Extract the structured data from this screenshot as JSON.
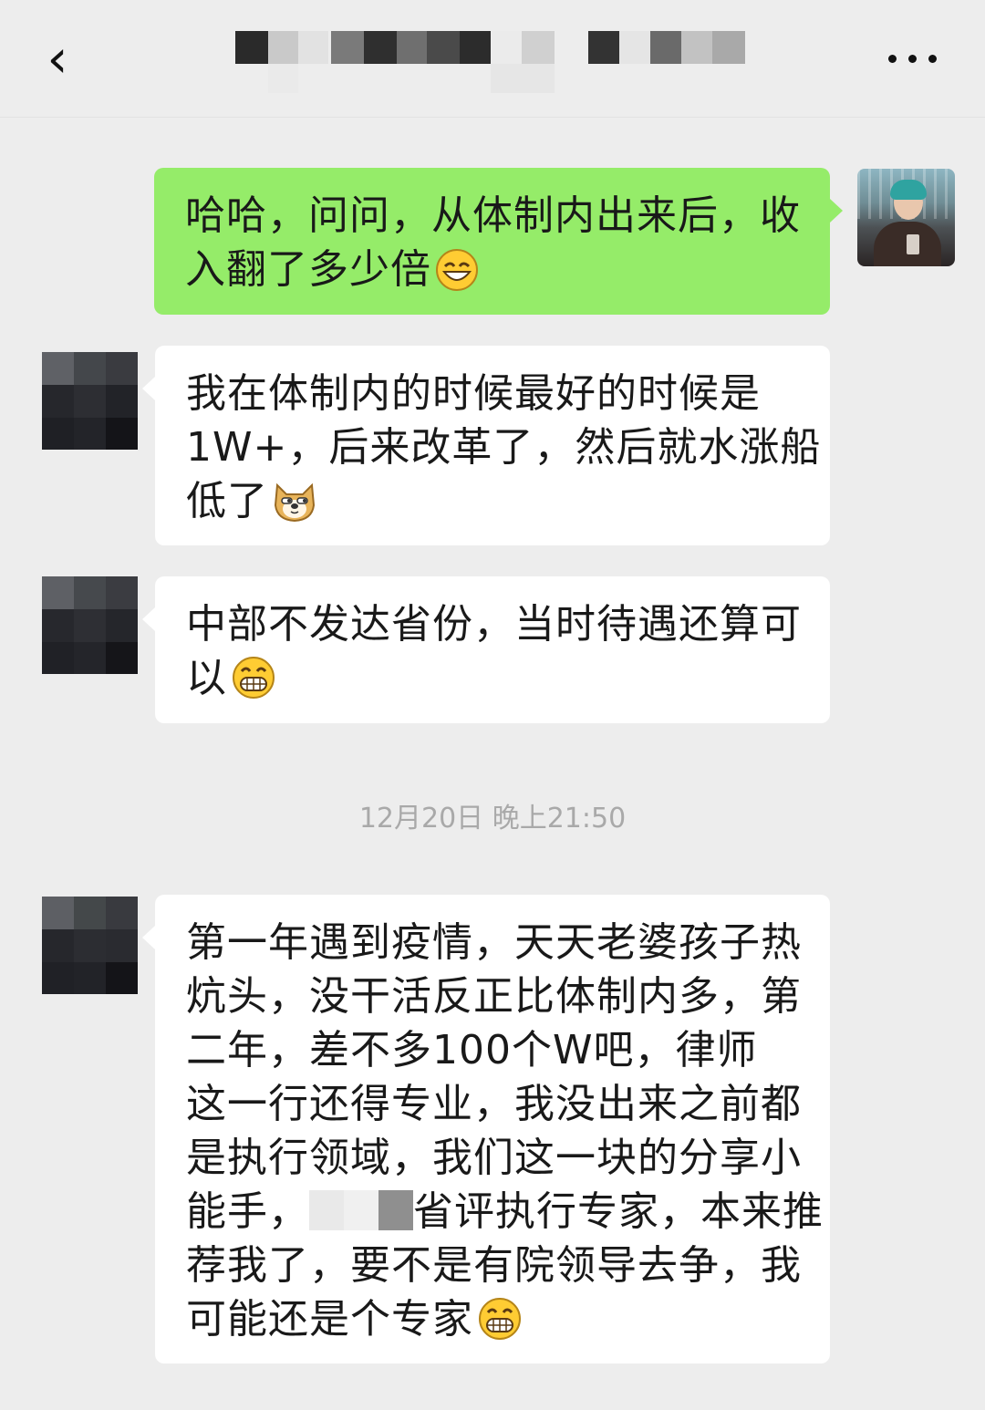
{
  "header": {
    "back_icon": "chevron-left-icon",
    "title_obscured": true,
    "more_icon": "more-dots-icon"
  },
  "messages": [
    {
      "sender": "me",
      "lines": [
        "哈哈，问问，从体制内出来后，收",
        "入翻了多少倍"
      ],
      "emoji": "grinning-face"
    },
    {
      "sender": "contact",
      "lines": [
        "我在体制内的时候最好的时候是",
        "1W+，后来改革了，然后就水涨船",
        "低了"
      ],
      "emoji": "doge"
    },
    {
      "sender": "contact",
      "lines": [
        "中部不发达省份，当时待遇还算可",
        "以"
      ],
      "emoji": "grimacing-grin"
    },
    {
      "sender": "contact",
      "lines": [
        "第一年遇到疫情，天天老婆孩子热",
        "炕头，没干活反正比体制内多，第",
        "二年，差不多100个W吧，律师",
        "这一行还得专业，我没出来之前都",
        "是执行领域，我们这一块的分享小",
        "能手，",
        "省评执行专家，本来推",
        "荐我了，要不是有院领导去争，我",
        "可能还是个专家"
      ],
      "emoji": "grimacing-grin"
    }
  ],
  "timestamp": "12月20日 晚上21:50",
  "colors": {
    "background": "#ededed",
    "my_bubble": "#95ec69",
    "their_bubble": "#ffffff",
    "text": "#191919",
    "timestamp": "#a9a9a9"
  }
}
